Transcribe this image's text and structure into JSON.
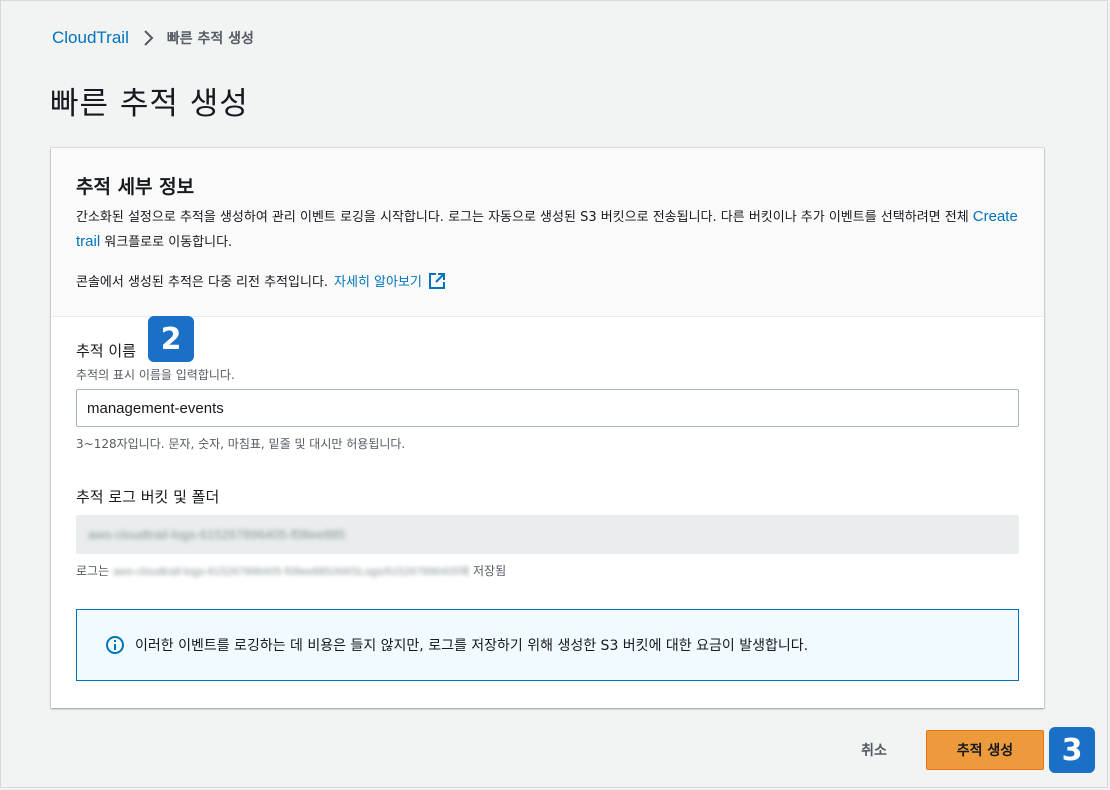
{
  "breadcrumb": {
    "root": "CloudTrail",
    "current": "빠른 추적 생성"
  },
  "page_title": "빠른 추적 생성",
  "details": {
    "title": "추적 세부 정보",
    "desc_part1": "간소화된 설정으로 추적을 생성하여 관리 이벤트 로깅을 시작합니다. 로그는 자동으로 생성된 S3 버킷으로 전송됩니다. 다른 버킷이나 추가 이벤트를 선택하려면 전체 ",
    "desc_link": "Create trail",
    "desc_part2": " 워크플로로 이동합니다.",
    "note": "콘솔에서 생성된 추적은 다중 리전 추적입니다.",
    "learn_more": "자세히 알아보기"
  },
  "trail_name": {
    "label": "추적 이름",
    "description": "추적의 표시 이름을 입력합니다.",
    "value": "management-events",
    "constraint": "3~128자입니다. 문자, 숫자, 마침표, 밑줄 및 대시만 허용됩니다."
  },
  "bucket": {
    "label": "추적 로그 버킷 및 폴더",
    "value": "aws-cloudtrail-logs-615267896405-f08ee885",
    "log_prefix": "로그는",
    "log_path": "aws-cloudtrail-logs-615267896405-f08ee885/AWSLogs/615267896405에",
    "log_suffix": "저장됨"
  },
  "info": {
    "text": "이러한 이벤트를 로깅하는 데 비용은 들지 않지만, 로그를 저장하기 위해 생성한 S3 버킷에 대한 요금이 발생합니다."
  },
  "badges": {
    "step2": "2",
    "step3": "3"
  },
  "actions": {
    "cancel": "취소",
    "create": "추적 생성"
  },
  "colors": {
    "link": "#0073bb",
    "primary_button": "#ec9a3c",
    "badge": "#1a6fc7",
    "info_border": "#0073bb"
  }
}
